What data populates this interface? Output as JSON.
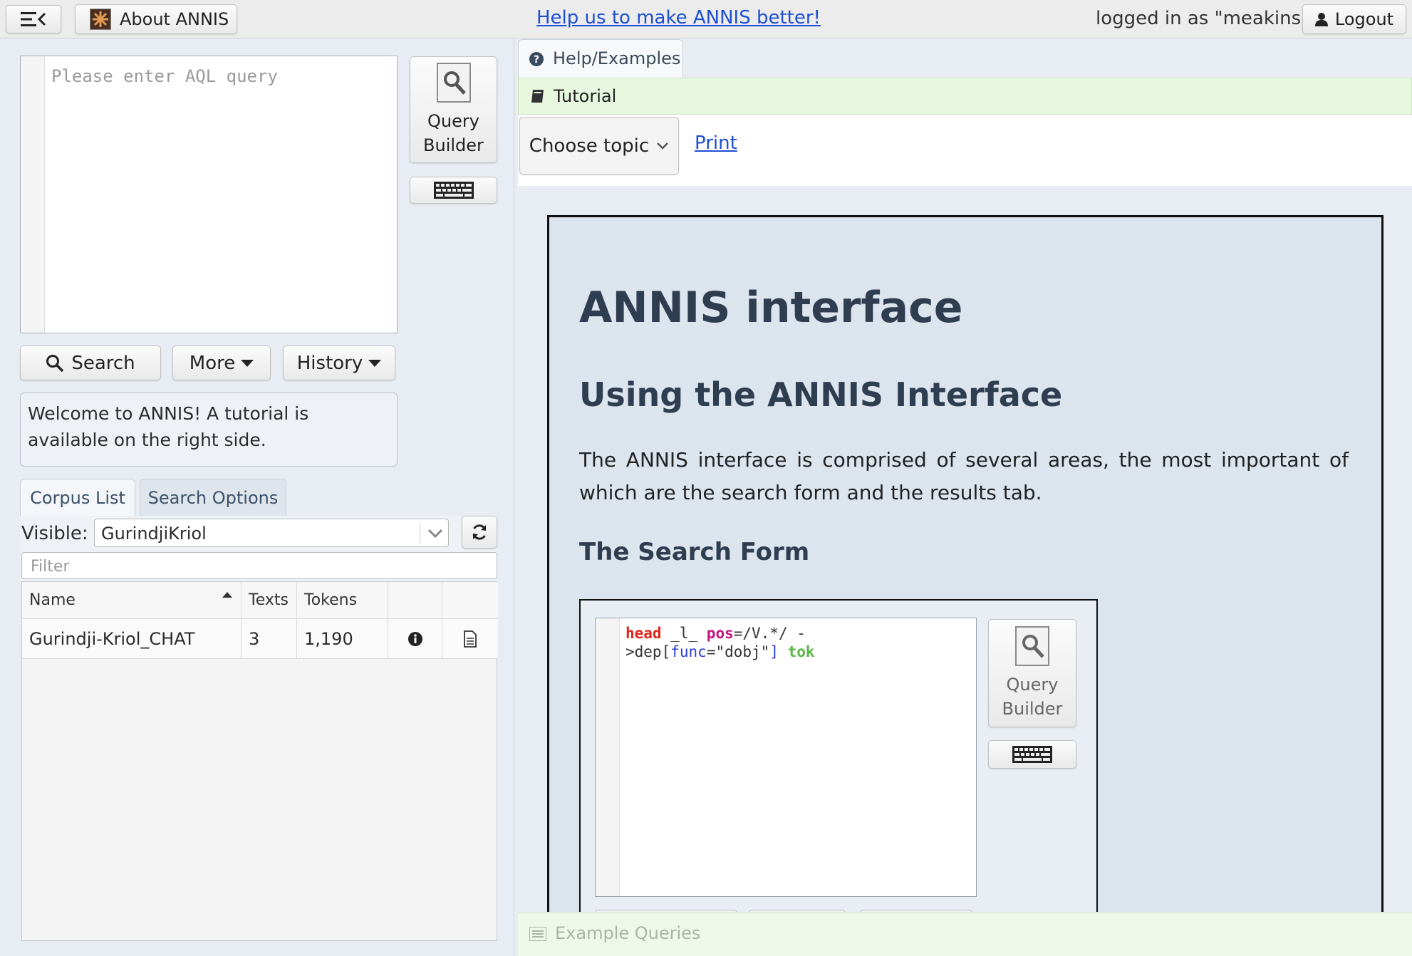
{
  "topbar": {
    "help_link": "Help us to make ANNIS better!",
    "about_label": "About ANNIS",
    "logged_in": "logged in as \"meakins\"",
    "logout_label": "Logout"
  },
  "query": {
    "placeholder": "Please enter AQL query",
    "builder_line1": "Query",
    "builder_line2": "Builder"
  },
  "actions": {
    "search": "Search",
    "more": "More",
    "history": "History"
  },
  "welcome": "Welcome to ANNIS! A tutorial is available on the right side.",
  "left_tabs": {
    "corpus_list": "Corpus List",
    "search_options": "Search Options"
  },
  "corpus": {
    "visible_label": "Visible:",
    "visible_value": "GurindjiKriol",
    "filter_placeholder": "Filter",
    "columns": [
      "Name",
      "Texts",
      "Tokens"
    ],
    "rows": [
      {
        "name": "Gurindji-Kriol_CHAT",
        "texts": "3",
        "tokens": "1,190"
      }
    ]
  },
  "help": {
    "tab_label": "Help/Examples",
    "tutorial_label": "Tutorial",
    "choose_topic": "Choose topic",
    "print": "Print",
    "example_queries": "Example Queries"
  },
  "doc": {
    "title": "ANNIS interface",
    "subtitle": "Using the ANNIS Interface",
    "paragraph": "The ANNIS interface is comprised of several areas, the most important of which are the search form and the results tab.",
    "section": "The Search Form",
    "example_code": {
      "t1": "head",
      "t2": " _l_ ",
      "t3": "pos",
      "t4": "=/V.*/ -",
      "t5": ">dep[",
      "t6": "func",
      "t7": "=\"dobj\"",
      "t8": "]",
      "t9": " tok"
    },
    "builder_line1": "Query",
    "builder_line2": "Builder"
  },
  "colors": {
    "accent_link": "#1d4fd3",
    "tutorial_bg": "#e7f8df",
    "code_red": "#e2231a",
    "code_magenta": "#c0177f",
    "code_blue": "#2a3fd8",
    "code_green": "#58b545"
  }
}
